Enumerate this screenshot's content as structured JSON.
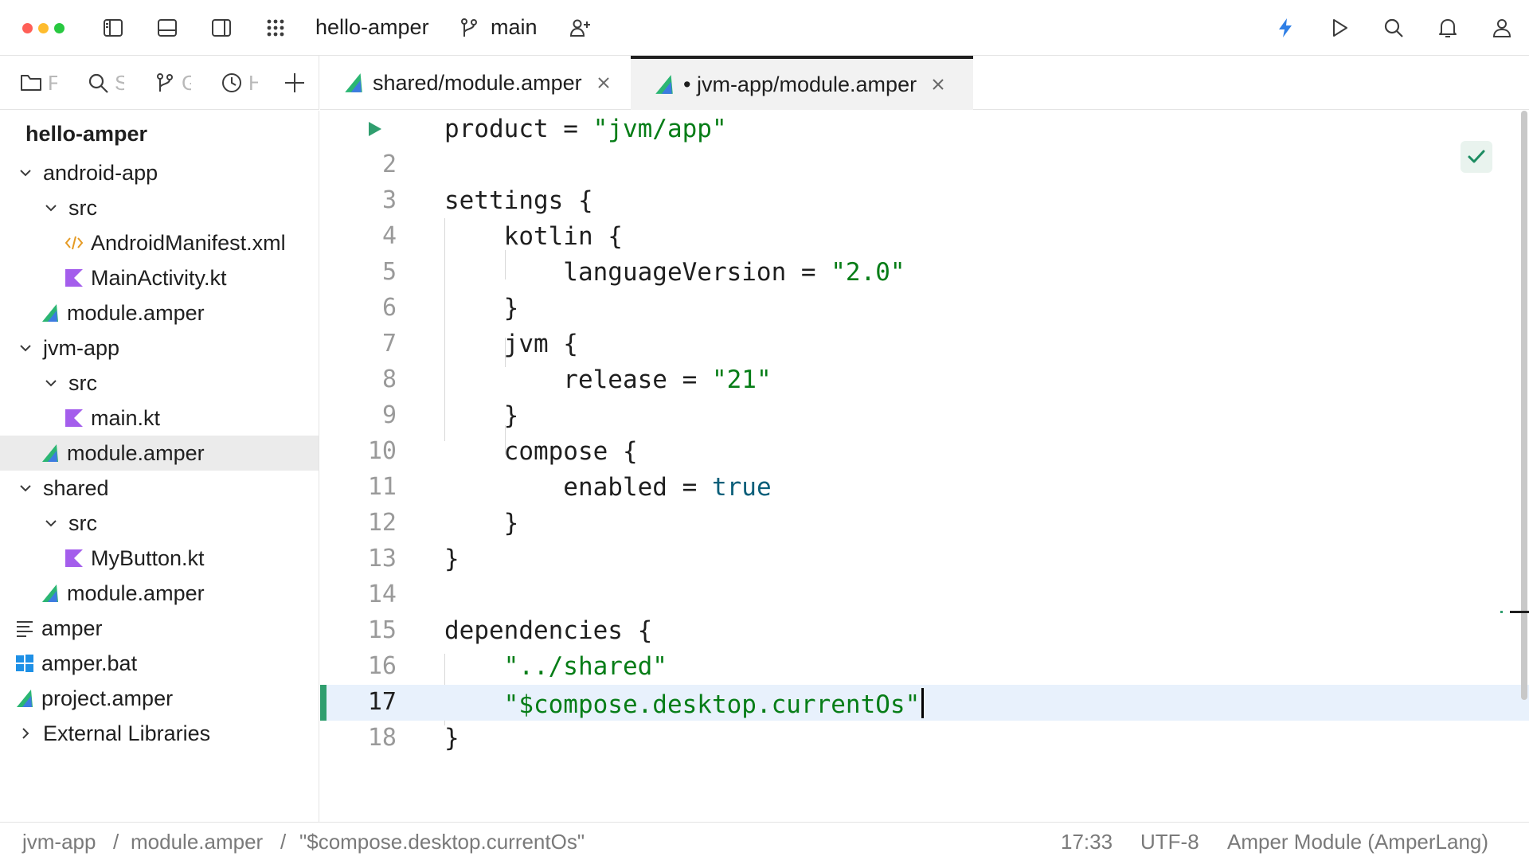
{
  "toolbar": {
    "project_name": "hello-amper",
    "branch": "main",
    "icons": [
      "sidebar-left-icon",
      "bottom-panel-icon",
      "sidebar-right-icon",
      "apps-grid-icon",
      "branch-icon",
      "add-user-icon",
      "lightning-icon",
      "run-icon",
      "search-icon",
      "bell-icon",
      "user-icon"
    ],
    "traffic_colors": {
      "close": "#ff5f57",
      "minimize": "#febc2e",
      "zoom": "#28c840"
    }
  },
  "toolstrip": {
    "items": [
      {
        "label": "F",
        "icon": "folder-icon"
      },
      {
        "label": "S",
        "icon": "search-icon"
      },
      {
        "label": "G",
        "icon": "branch-icon"
      },
      {
        "label": "H",
        "icon": "clock-icon"
      }
    ]
  },
  "tree": {
    "root": "hello-amper",
    "rows": [
      {
        "label": "android-app",
        "kind": "folder"
      },
      {
        "label": "src",
        "kind": "folder"
      },
      {
        "label": "AndroidManifest.xml",
        "kind": "xml"
      },
      {
        "label": "MainActivity.kt",
        "kind": "kotlin"
      },
      {
        "label": "module.amper",
        "kind": "amper"
      },
      {
        "label": "jvm-app",
        "kind": "folder"
      },
      {
        "label": "src",
        "kind": "folder"
      },
      {
        "label": "main.kt",
        "kind": "kotlin"
      },
      {
        "label": "module.amper",
        "kind": "amper"
      },
      {
        "label": "shared",
        "kind": "folder"
      },
      {
        "label": "src",
        "kind": "folder"
      },
      {
        "label": "MyButton.kt",
        "kind": "kotlin"
      },
      {
        "label": "module.amper",
        "kind": "amper"
      },
      {
        "label": "amper",
        "kind": "text"
      },
      {
        "label": "amper.bat",
        "kind": "windows"
      },
      {
        "label": "project.amper",
        "kind": "amper"
      },
      {
        "label": "External Libraries",
        "kind": "libraries"
      }
    ]
  },
  "tabs": [
    {
      "label": "shared/module.amper",
      "active": false,
      "modified": false
    },
    {
      "label": "• jvm-app/module.amper",
      "active": true,
      "modified": true
    }
  ],
  "editor": {
    "line_numbers": [
      "",
      "2",
      "3",
      "4",
      "5",
      "6",
      "7",
      "8",
      "9",
      "10",
      "11",
      "12",
      "13",
      "14",
      "15",
      "16",
      "17",
      "18"
    ],
    "lines": [
      {
        "pre": "product = ",
        "str": "\"jvm/app\"",
        "post": ""
      },
      {
        "pre": "",
        "str": "",
        "post": ""
      },
      {
        "pre": "settings {",
        "str": "",
        "post": ""
      },
      {
        "pre": "    kotlin {",
        "str": "",
        "post": ""
      },
      {
        "pre": "        languageVersion = ",
        "str": "\"2.0\"",
        "post": ""
      },
      {
        "pre": "    }",
        "str": "",
        "post": ""
      },
      {
        "pre": "    jvm {",
        "str": "",
        "post": ""
      },
      {
        "pre": "        release = ",
        "str": "\"21\"",
        "post": ""
      },
      {
        "pre": "    }",
        "str": "",
        "post": ""
      },
      {
        "pre": "    compose {",
        "str": "",
        "post": ""
      },
      {
        "pre": "        enabled = ",
        "str": "",
        "post": "",
        "kw": "true"
      },
      {
        "pre": "    }",
        "str": "",
        "post": ""
      },
      {
        "pre": "}",
        "str": "",
        "post": ""
      },
      {
        "pre": "",
        "str": "",
        "post": ""
      },
      {
        "pre": "dependencies {",
        "str": "",
        "post": ""
      },
      {
        "pre": "    ",
        "str": "\"../shared\"",
        "post": ""
      },
      {
        "pre": "    ",
        "str": "\"$compose.desktop.currentOs\"",
        "post": ""
      },
      {
        "pre": "}",
        "str": "",
        "post": ""
      }
    ],
    "current_line": 17,
    "inspection_icon": "check-icon"
  },
  "statusbar": {
    "breadcrumbs": [
      "jvm-app",
      "module.amper",
      "\"$compose.desktop.currentOs\""
    ],
    "separator": "/",
    "position": "17:33",
    "encoding": "UTF-8",
    "file_type": "Amper Module (AmperLang)"
  },
  "colors": {
    "amper_green": "#2bb673",
    "amper_blue": "#3d7be0",
    "kotlin_purple": "#a45eec",
    "xml_orange": "#e59a23",
    "string_green": "#067d17",
    "keyword_teal": "#0b5f7a",
    "accent_blue": "#2f7fe6",
    "current_line_bg": "#e8f1fc"
  }
}
